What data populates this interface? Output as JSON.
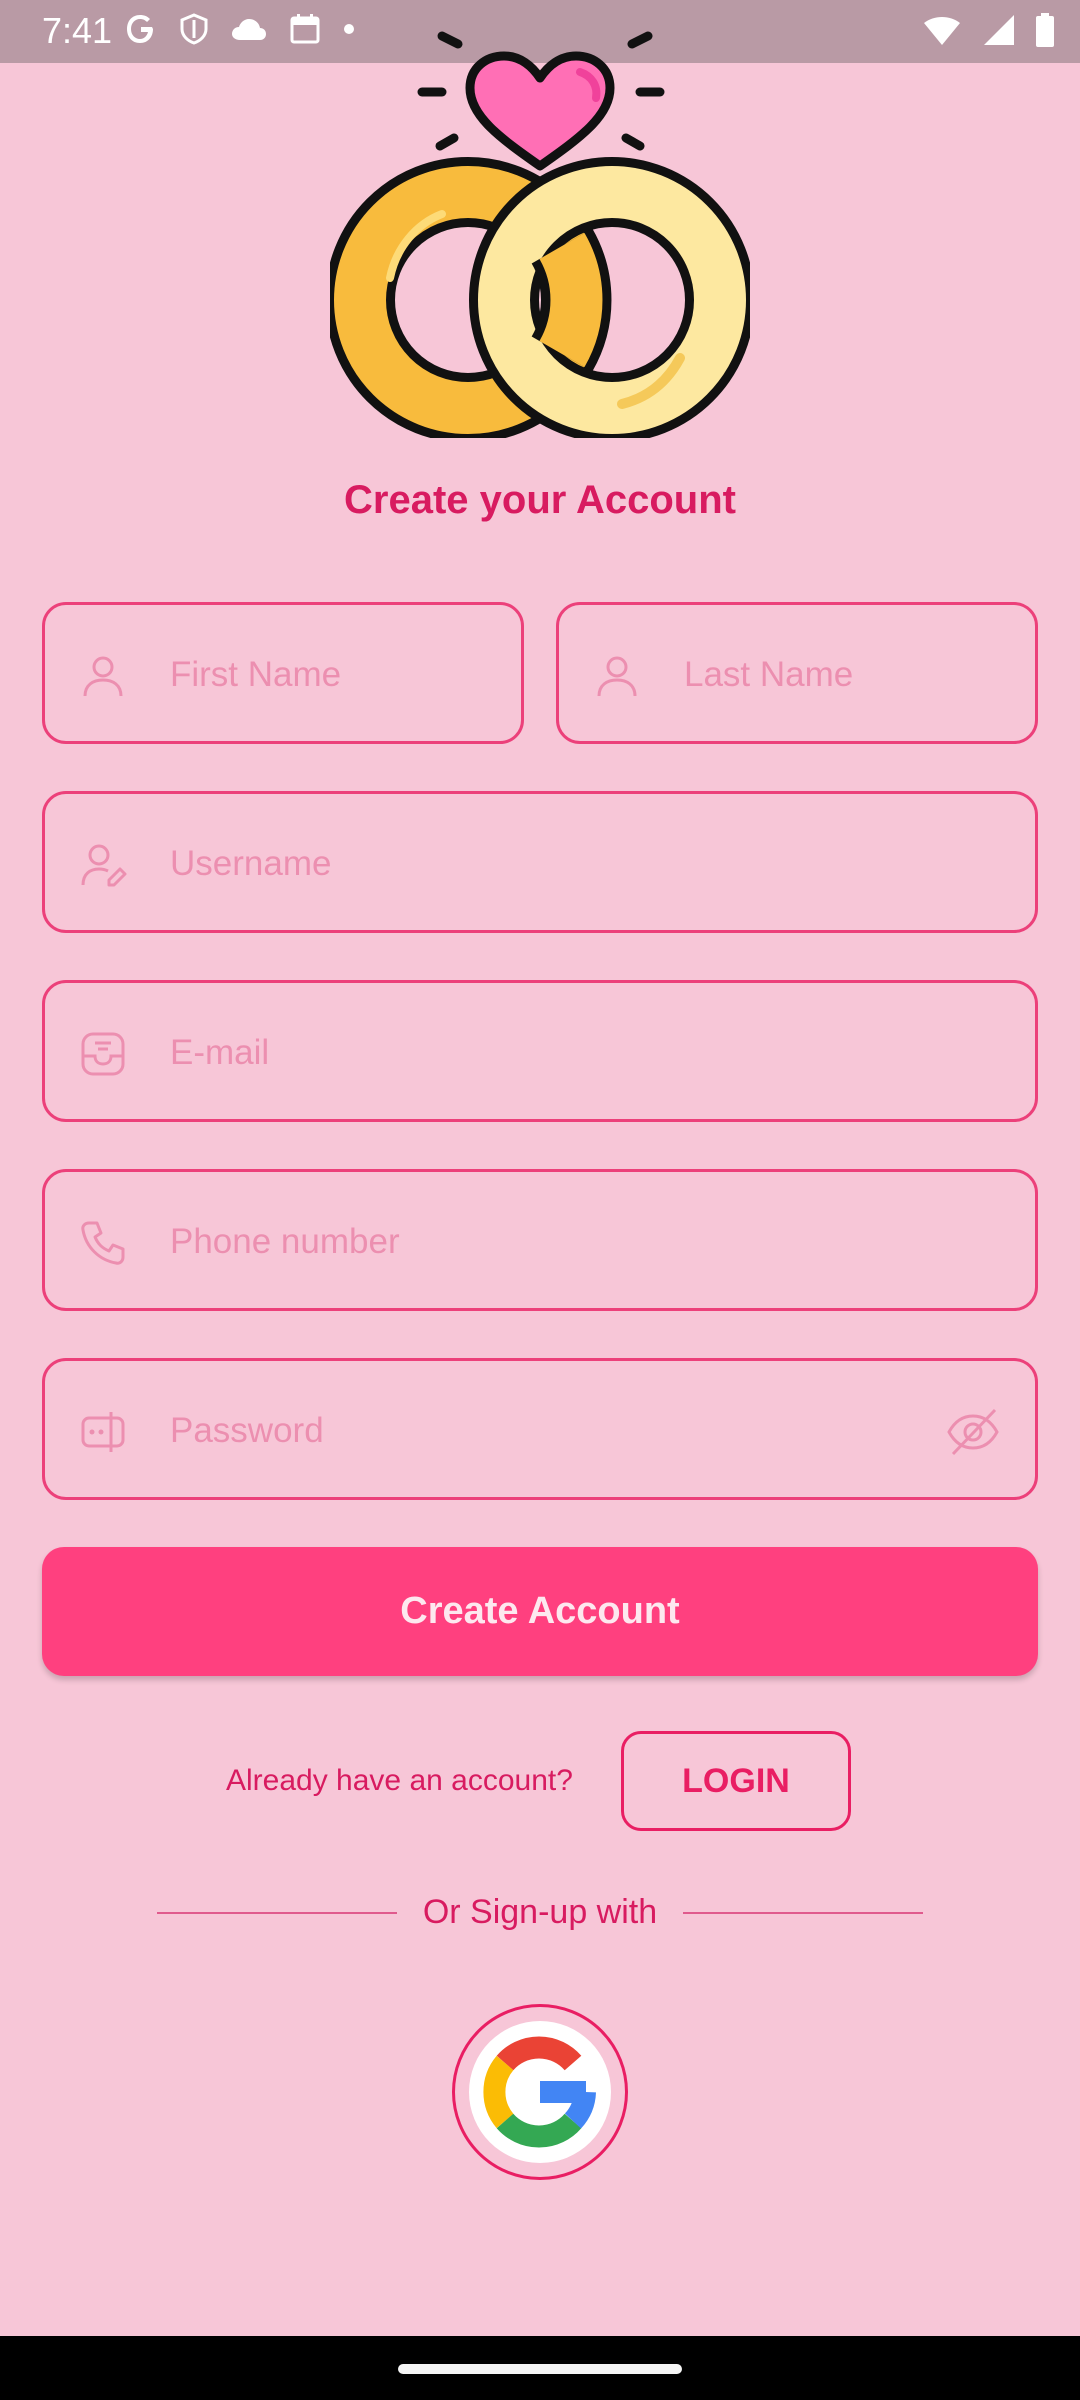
{
  "status_bar": {
    "time": "7:41"
  },
  "hero": {
    "icon": "wedding-rings-heart"
  },
  "title": "Create your Account",
  "form": {
    "first_name_placeholder": "First Name",
    "last_name_placeholder": "Last Name",
    "username_placeholder": "Username",
    "email_placeholder": "E-mail",
    "phone_placeholder": "Phone number",
    "password_placeholder": "Password"
  },
  "create_account_label": "Create Account",
  "login_prompt": "Already have an account?",
  "login_label": "LOGIN",
  "or_signup_label": "Or Sign-up with",
  "colors": {
    "background": "#f7c6d7",
    "accent": "#e91e63",
    "button": "#ff407f"
  }
}
